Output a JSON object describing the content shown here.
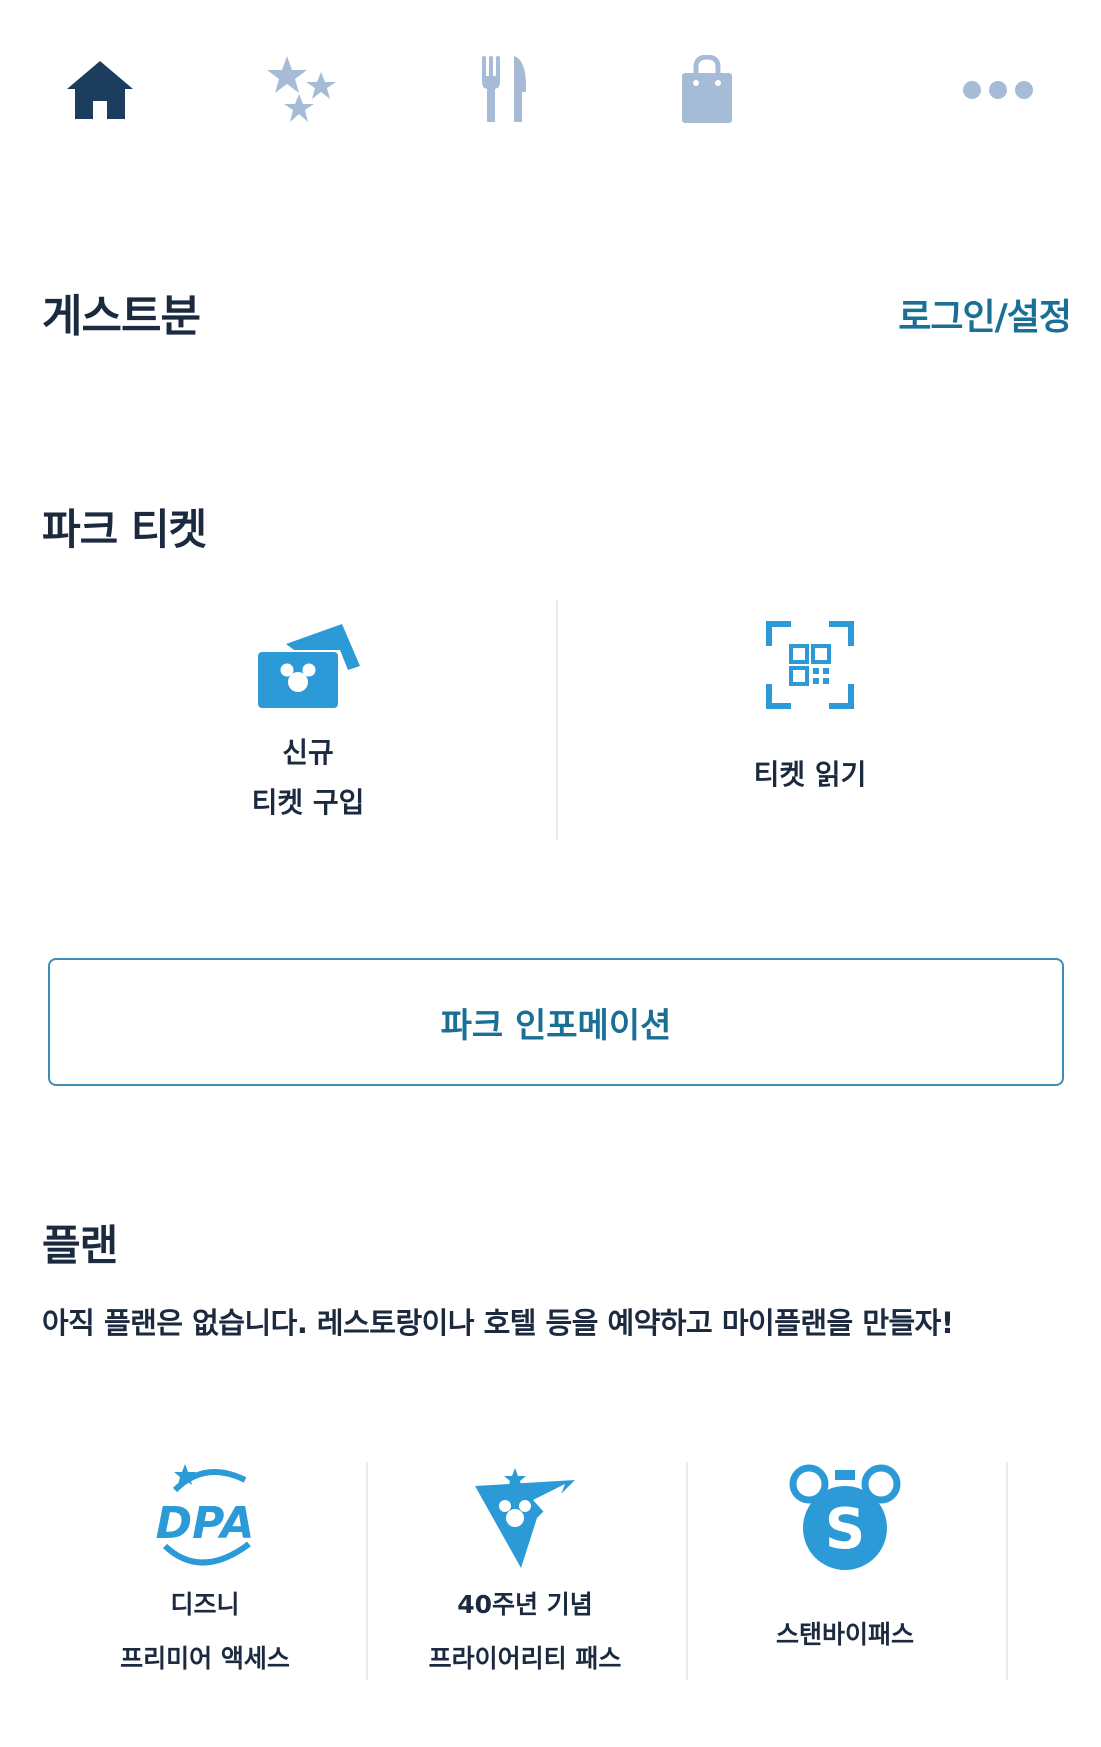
{
  "nav": [
    {
      "icon": "home-icon",
      "active": true
    },
    {
      "icon": "stars-icon",
      "active": false
    },
    {
      "icon": "fork-knife-icon",
      "active": false
    },
    {
      "icon": "shopping-bag-icon",
      "active": false
    },
    {
      "icon": "more-icon",
      "active": false
    }
  ],
  "colors": {
    "active": "#1c3d5e",
    "inactive": "#a6bcd6",
    "accent": "#2d9ad8",
    "link": "#1a6f95"
  },
  "header": {
    "guest_label": "게스트분",
    "login_label": "로그인/설정"
  },
  "tickets": {
    "title": "파크 티켓",
    "new_purchase_line1": "신규",
    "new_purchase_line2": "티켓 구입",
    "read_ticket": "티켓 읽기"
  },
  "park_info_button": "파크 인포메이션",
  "plan": {
    "title": "플랜",
    "empty_message": "아직 플랜은 없습니다. 레스토랑이나 호텔 등을 예약하고 마이플랜을 만들자!",
    "items": [
      {
        "icon": "dpa-icon",
        "line1": "디즈니",
        "line2": "프리미어 액세스"
      },
      {
        "icon": "priority-pass-icon",
        "line1": "40주년 기념",
        "line2": "프라이어리티 패스"
      },
      {
        "icon": "standby-pass-icon",
        "line1": "스탠바이패스",
        "line2": ""
      }
    ]
  }
}
